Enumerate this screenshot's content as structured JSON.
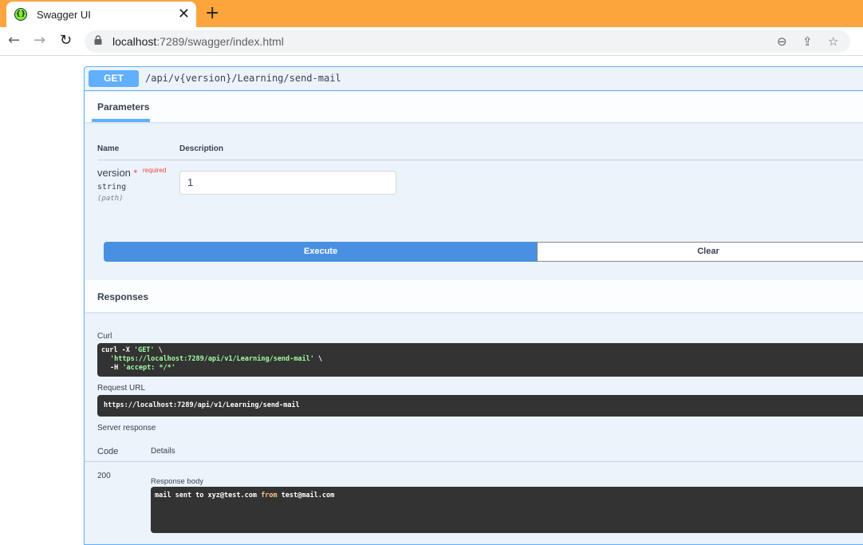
{
  "browser": {
    "tab_title": "Swagger UI",
    "close_glyph": "✕",
    "new_tab_glyph": "+",
    "url_host": "localhost",
    "url_rest": ":7289/swagger/index.html",
    "nav": {
      "back": "←",
      "forward": "→",
      "reload": "↻"
    },
    "omnibox_icons": {
      "zoom": "⊖",
      "share": "⇪",
      "bookmark": "☆"
    }
  },
  "operation": {
    "method": "GET",
    "path": "/api/v{version}/Learning/send-mail"
  },
  "parameters": {
    "tab_label": "Parameters",
    "col_name": "Name",
    "col_description": "Description",
    "items": [
      {
        "name": "version",
        "required_star": "*",
        "required_label": "required",
        "type": "string",
        "in": "(path)",
        "value": "1"
      }
    ]
  },
  "actions": {
    "execute": "Execute",
    "clear": "Clear"
  },
  "responses": {
    "title": "Responses",
    "curl_label": "Curl",
    "curl": {
      "line1_cmd": "curl -X ",
      "line1_str": "'GET'",
      "line1_tail": " \\",
      "line2_str": "'https://localhost:7289/api/v1/Learning/send-mail'",
      "line2_tail": " \\",
      "line3_cmd": "-H ",
      "line3_str": "'accept: */*'"
    },
    "request_url_label": "Request URL",
    "request_url": "https://localhost:7289/api/v1/Learning/send-mail",
    "server_response_label": "Server response",
    "code_head": "Code",
    "details_head": "Details",
    "status_code": "200",
    "body_label": "Response body",
    "body": {
      "part1": "mail sent to xyz@test.com ",
      "kw": "from",
      "part2": " test@mail.com"
    }
  },
  "colors": {
    "accent_get": "#61affe",
    "execute": "#4990e2",
    "tab_bar": "#fba53c",
    "code_bg": "#333333"
  }
}
